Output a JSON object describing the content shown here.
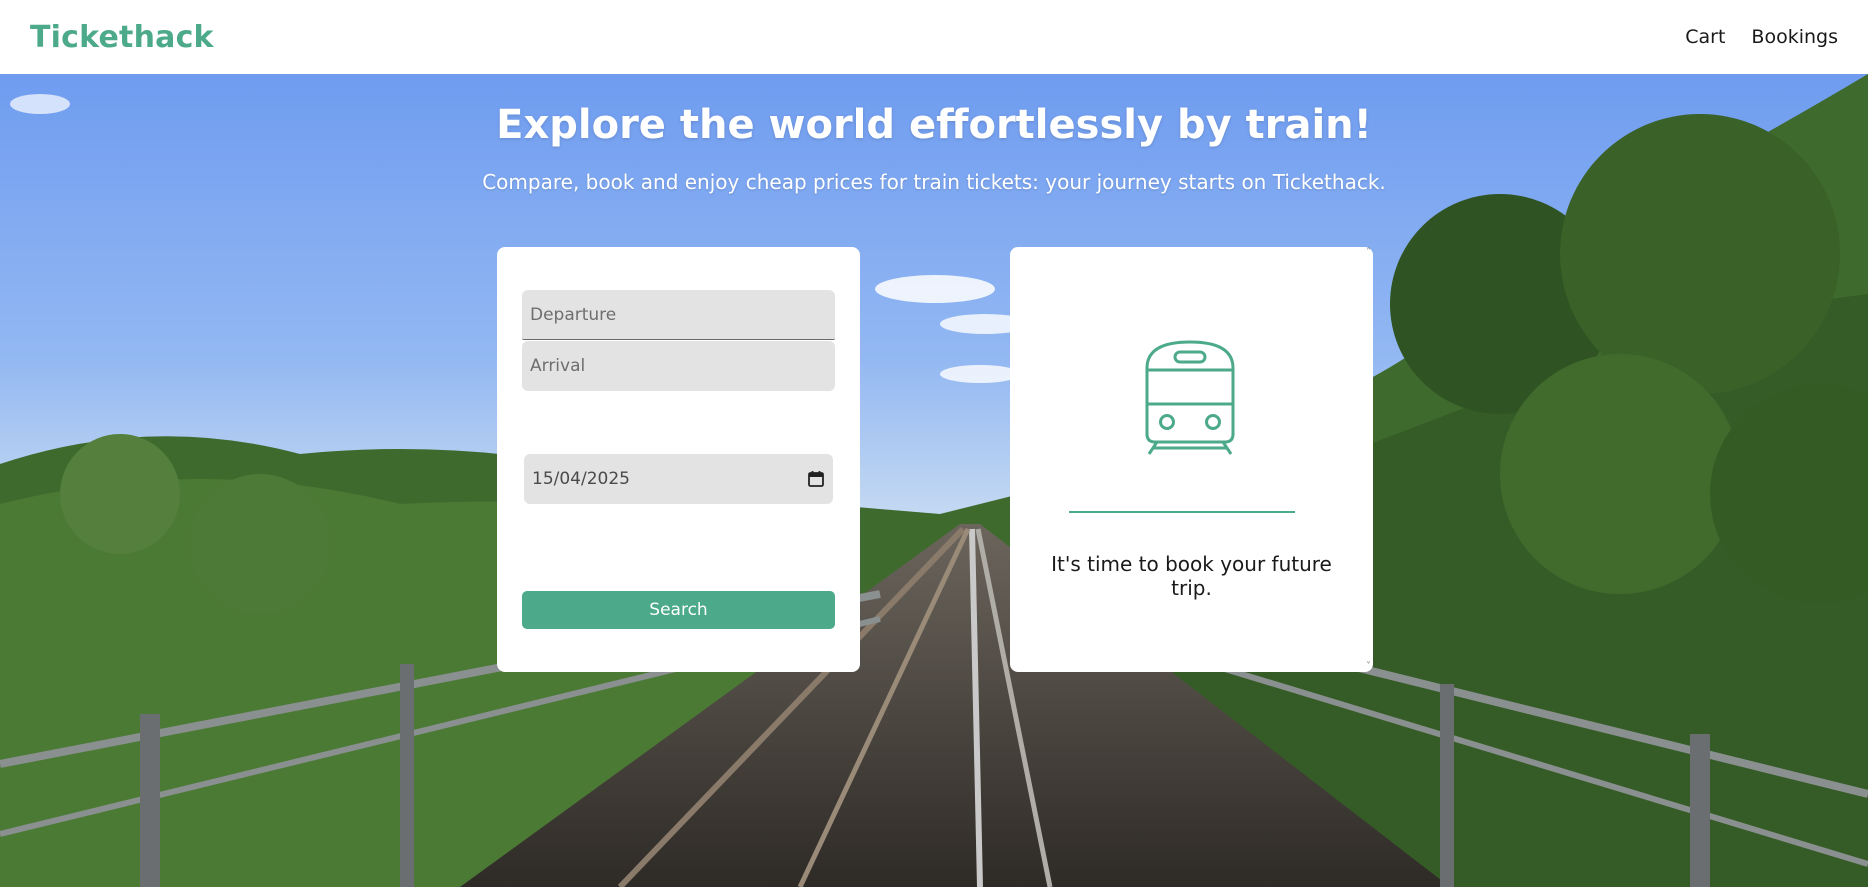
{
  "header": {
    "brand": "Tickethack",
    "nav": [
      {
        "label": "Cart"
      },
      {
        "label": "Bookings"
      }
    ]
  },
  "hero": {
    "title": "Explore the world effortlessly by train!",
    "subtitle": "Compare, book and enjoy cheap prices for train tickets: your journey starts on Tickethack."
  },
  "search_form": {
    "departure_placeholder": "Departure",
    "arrival_placeholder": "Arrival",
    "date_value": "15/04/2025",
    "date_icon": "calendar-icon",
    "search_label": "Search"
  },
  "info_card": {
    "icon": "train-icon",
    "text": "It's time to book your future trip."
  },
  "colors": {
    "accent": "#4caa8a",
    "field_bg": "#e3e3e3",
    "card_bg": "#ffffff"
  }
}
